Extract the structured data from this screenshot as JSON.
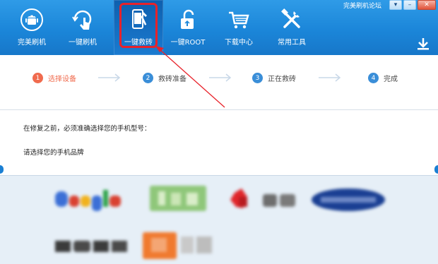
{
  "window": {
    "title": "完美刷机论坛",
    "buttons": [
      "▾",
      "–",
      "✕"
    ]
  },
  "toolbar": {
    "items": [
      {
        "label": "完美刷机",
        "icon": "android-icon"
      },
      {
        "label": "一键刷机",
        "icon": "touch-refresh-icon"
      },
      {
        "label": "一键救砖",
        "icon": "phone-repair-icon",
        "active": true
      },
      {
        "label": "一键ROOT",
        "icon": "unlock-icon"
      },
      {
        "label": "下载中心",
        "icon": "cart-icon"
      },
      {
        "label": "常用工具",
        "icon": "tools-icon"
      }
    ],
    "download_icon": "download-icon"
  },
  "steps": [
    {
      "num": "1",
      "label": "选择设备",
      "current": true
    },
    {
      "num": "2",
      "label": "救砖准备",
      "current": false
    },
    {
      "num": "3",
      "label": "正在救砖",
      "current": false
    },
    {
      "num": "4",
      "label": "完成",
      "current": false
    }
  ],
  "main": {
    "prompt_model": "在修复之前，必须准确选择您的手机型号：",
    "prompt_brand": "请选择您的手机品牌"
  },
  "brands": [
    {
      "name": "google-logo"
    },
    {
      "name": "htc-logo"
    },
    {
      "name": "huawei-logo"
    },
    {
      "name": "samsung-logo"
    },
    {
      "name": "sony-logo"
    },
    {
      "name": "xiaomi-logo"
    }
  ],
  "colors": {
    "toolbar": "#1b86d9",
    "highlight": "#e8222a",
    "step_current": "#f06b4e",
    "step_other": "#3a8ed8",
    "brand_area": "#e6eff7"
  }
}
